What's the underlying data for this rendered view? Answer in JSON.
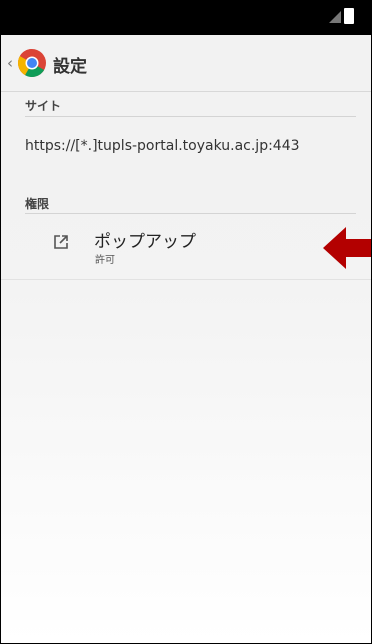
{
  "app_bar": {
    "title": "設定",
    "back_glyph": "‹",
    "logo_icon": "chrome-logo-icon"
  },
  "site_section": {
    "header": "サイト",
    "url": "https://[*.]tupls-portal.toyaku.ac.jp:443"
  },
  "permissions_section": {
    "header": "権限",
    "items": [
      {
        "icon": "open-in-new-icon",
        "label": "ポップアップ",
        "status": "許可"
      }
    ]
  },
  "status_bar": {
    "icons": [
      "signal-icon",
      "battery-icon"
    ]
  },
  "annotation": {
    "icon": "left-arrow-icon",
    "color": "#b30000"
  },
  "colors": {
    "status_bar": "#000000",
    "app_bar": "#f2f2f2",
    "background": "#f3f3f3"
  }
}
